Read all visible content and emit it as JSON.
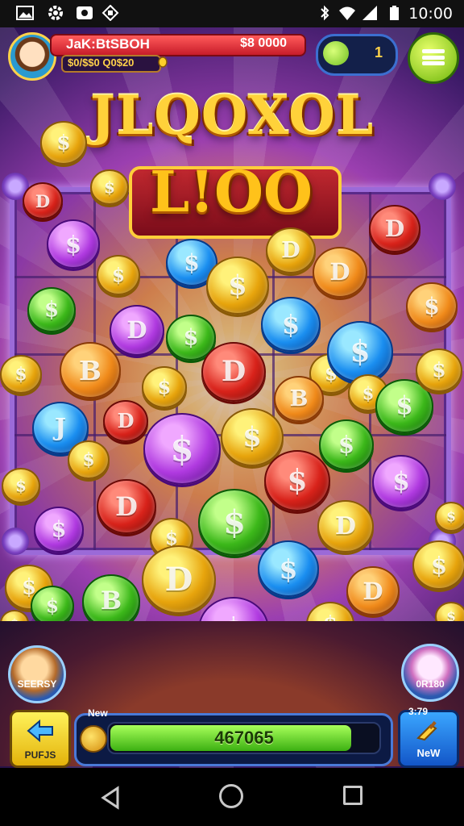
{
  "status_bar": {
    "time": "10:00",
    "icons": [
      "gallery-icon",
      "settings-gear-icon",
      "camera-icon",
      "puzzle-icon",
      "bluetooth-icon",
      "wifi-icon",
      "signal-icon",
      "battery-icon"
    ]
  },
  "header": {
    "player_name": "JaK:BtSBOH",
    "player_score": "$8 0000",
    "sub_value": "$0/$$0 Q0$20",
    "counter_value": "1"
  },
  "title": {
    "line1": "JLQOXOL",
    "line2": "L!OO"
  },
  "coin_symbols": {
    "dollar": "$",
    "d": "D",
    "b": "B",
    "j": "J"
  },
  "left_round_label": "SEERSY",
  "right_round_label": "0R180",
  "bottom": {
    "left_button_label": "PUFJS",
    "progress_small_label": "New",
    "progress_value": "467065",
    "progress_fraction": 0.9,
    "right_button_top": "3:79",
    "right_button_label": "NeW"
  },
  "colors": {
    "accent_gold": "#ffd23a",
    "accent_green": "#3cb012",
    "frame_purple": "#9b6ad8"
  }
}
